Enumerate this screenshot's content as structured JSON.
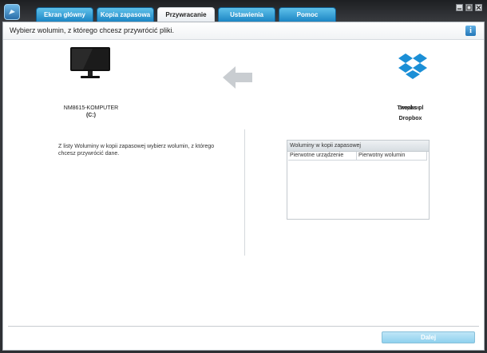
{
  "tabs": [
    {
      "label": "Ekran główny"
    },
    {
      "label": "Kopia zapasowa"
    },
    {
      "label": "Przywracanie"
    },
    {
      "label": "Ustawienia"
    },
    {
      "label": "Pomoc"
    }
  ],
  "active_tab": "Przywracanie",
  "instruction": "Wybierz wolumin, z którego chcesz przywrócić pliki.",
  "info_icon_glyph": "i",
  "source": {
    "computer_name": "NM8615-KOMPUTER",
    "drive": "(C:)",
    "icon": "monitor-icon"
  },
  "destination": {
    "name": "Dropbox",
    "title_line1": "Tweaks pl",
    "title_line2": "Dropbox",
    "icon": "dropbox-icon"
  },
  "help_text": "Z listy Woluminy w kopii zapasowej wybierz wolumin, z którego chcesz przywrócić dane.",
  "volumes_panel": {
    "title": "Woluminy w kopii zapasowej",
    "columns": [
      "Pierwotne urządzenie",
      "Pierwotny wolumin"
    ],
    "rows": []
  },
  "next_button": "Dalej",
  "colors": {
    "tab_blue": "#1d86c4",
    "accent": "#2477b8",
    "next_button_disabled": "#a7dbf2"
  }
}
